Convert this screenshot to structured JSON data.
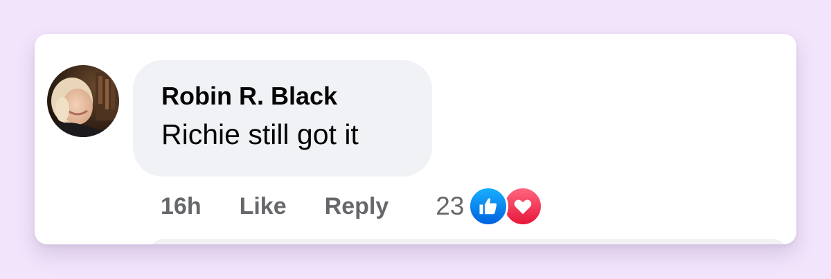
{
  "comment": {
    "author": "Robin R. Black",
    "text": "Richie still got it",
    "timestamp": "16h",
    "like_label": "Like",
    "reply_label": "Reply",
    "reaction_count": "23",
    "reactions": [
      "like-icon",
      "love-icon"
    ]
  },
  "colors": {
    "background": "#f2e4fb",
    "bubble": "#f0f2f5",
    "meta_text": "#65676b",
    "like_blue": "#0866ff",
    "love_red": "#f33e58"
  }
}
